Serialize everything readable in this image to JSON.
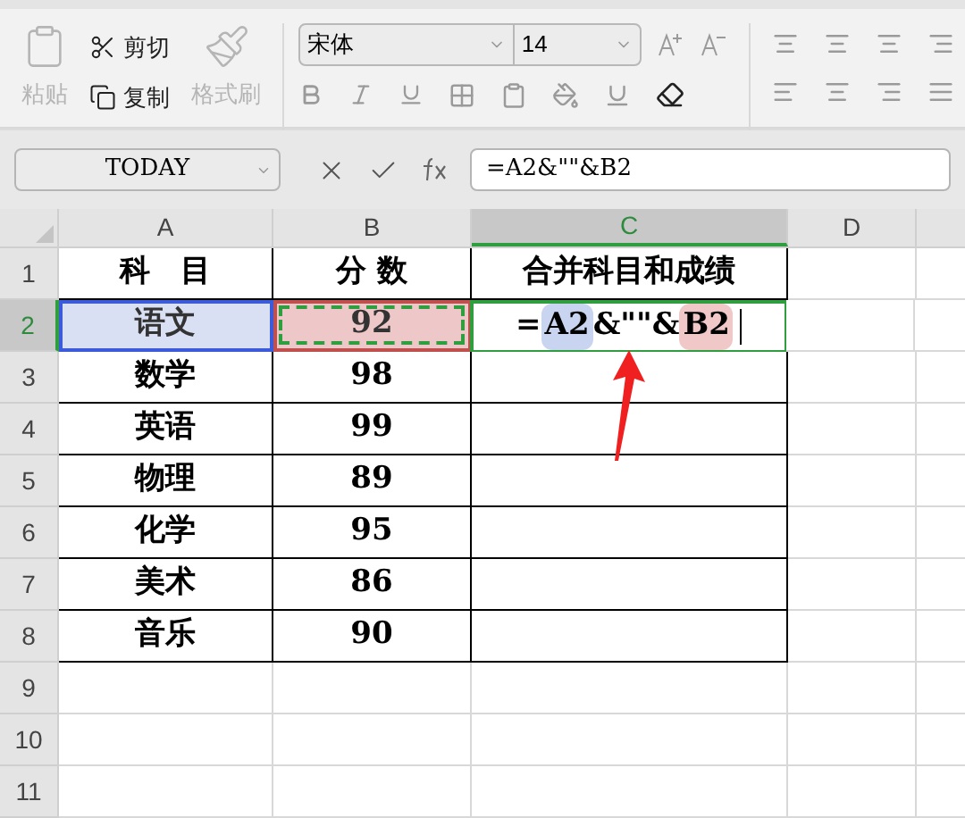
{
  "ribbon": {
    "clipboard": [
      {
        "kind": "paste",
        "label": "粘贴",
        "disabled": true
      },
      {
        "kind": "cut",
        "label": "剪切",
        "disabled": false
      },
      {
        "kind": "copy",
        "label": "复制",
        "disabled": false
      },
      {
        "kind": "format_painter",
        "label": "格式刷",
        "disabled": true
      }
    ],
    "font": {
      "name": "宋体",
      "size": "14"
    }
  },
  "formula_bar": {
    "name_box": "TODAY",
    "formula": "=A2&\"\"&B2"
  },
  "columns": [
    {
      "label": "A",
      "selected": false
    },
    {
      "label": "B",
      "selected": false
    },
    {
      "label": "C",
      "selected": true
    },
    {
      "label": "D",
      "selected": false
    }
  ],
  "rows": [
    {
      "label": "1",
      "selected": false,
      "cells": [
        {
          "text": "科　目"
        },
        {
          "text": "分 数"
        },
        {
          "text": "合并科目和成绩"
        }
      ]
    },
    {
      "label": "2",
      "selected": true,
      "cells": [
        {
          "text": "语文",
          "color": "#dae0f3"
        },
        {
          "text": "92",
          "color": "#eec8c8",
          "copied": true
        },
        {
          "parts": [
            {
              "kind": "text",
              "text": "="
            },
            {
              "kind": "ref",
              "text": "A2",
              "color": "#c9d4f0"
            },
            {
              "kind": "text",
              "text": "&\"\"&"
            },
            {
              "kind": "ref",
              "text": "B2",
              "color": "#f0c8c8"
            }
          ]
        }
      ]
    },
    {
      "label": "3",
      "selected": false,
      "cells": [
        {
          "text": "数学"
        },
        {
          "text": "98"
        },
        {
          "text": ""
        }
      ]
    },
    {
      "label": "4",
      "selected": false,
      "cells": [
        {
          "text": "英语"
        },
        {
          "text": "99"
        },
        {
          "text": ""
        }
      ]
    },
    {
      "label": "5",
      "selected": false,
      "cells": [
        {
          "text": "物理"
        },
        {
          "text": "89"
        },
        {
          "text": ""
        }
      ]
    },
    {
      "label": "6",
      "selected": false,
      "cells": [
        {
          "text": "化学"
        },
        {
          "text": "95"
        },
        {
          "text": ""
        }
      ]
    },
    {
      "label": "7",
      "selected": false,
      "cells": [
        {
          "text": "美术"
        },
        {
          "text": "86"
        },
        {
          "text": ""
        }
      ]
    },
    {
      "label": "8",
      "selected": false,
      "cells": [
        {
          "text": "音乐"
        },
        {
          "text": "90"
        },
        {
          "text": ""
        }
      ]
    },
    {
      "label": "9",
      "selected": false
    },
    {
      "label": "10",
      "selected": false
    },
    {
      "label": "11",
      "selected": false
    }
  ]
}
